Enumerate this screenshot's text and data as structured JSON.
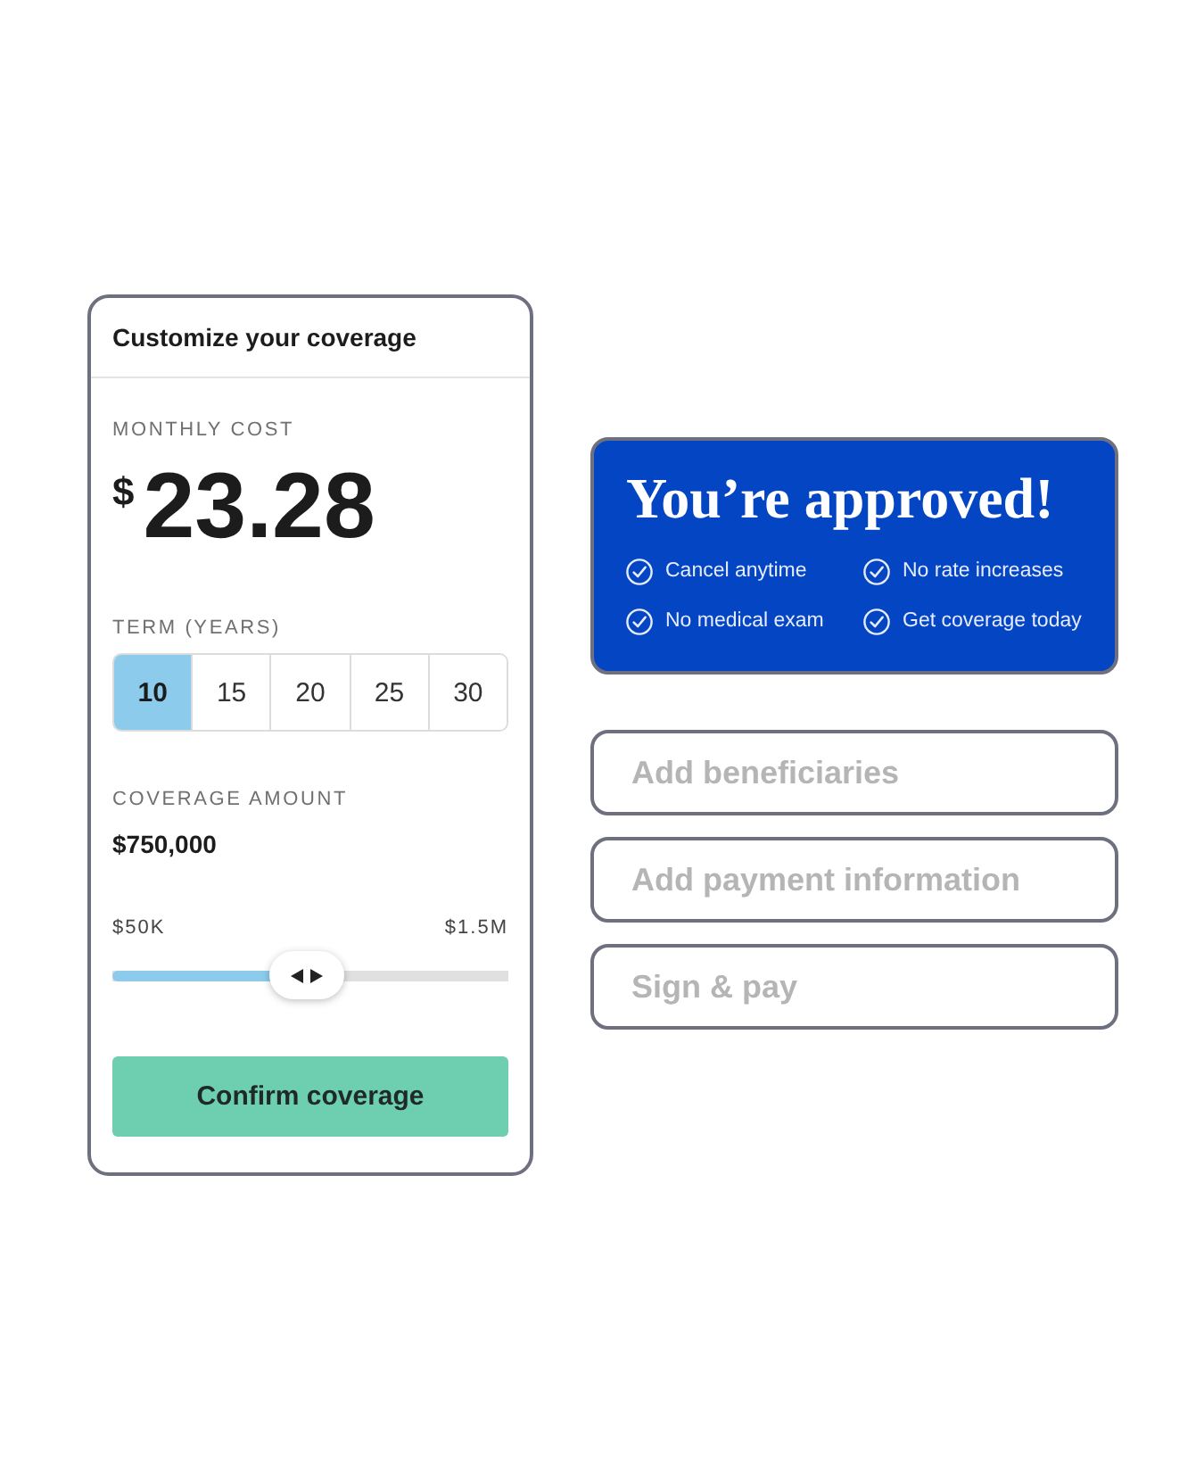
{
  "coverage_card": {
    "title": "Customize your coverage",
    "monthly_cost": {
      "label": "MONTHLY COST",
      "currency": "$",
      "amount": "23.28"
    },
    "term": {
      "label": "TERM (YEARS)",
      "options": [
        {
          "label": "10",
          "selected": true
        },
        {
          "label": "15",
          "selected": false
        },
        {
          "label": "20",
          "selected": false
        },
        {
          "label": "25",
          "selected": false
        },
        {
          "label": "30",
          "selected": false
        }
      ]
    },
    "coverage_amount": {
      "label": "COVERAGE AMOUNT",
      "value": "$750,000",
      "slider": {
        "min_label": "$50K",
        "max_label": "$1.5M",
        "level": 0.49
      }
    },
    "confirm_button": {
      "label": "Confirm coverage"
    }
  },
  "approval_card": {
    "title": "You’re approved!",
    "benefits": [
      "Cancel anytime",
      "No rate increases",
      "No medical exam",
      "Get coverage today"
    ]
  },
  "steps": [
    {
      "label": "Add beneficiaries",
      "disabled": true
    },
    {
      "label": "Add payment information",
      "disabled": true
    },
    {
      "label": "Sign & pay",
      "disabled": true
    }
  ]
}
